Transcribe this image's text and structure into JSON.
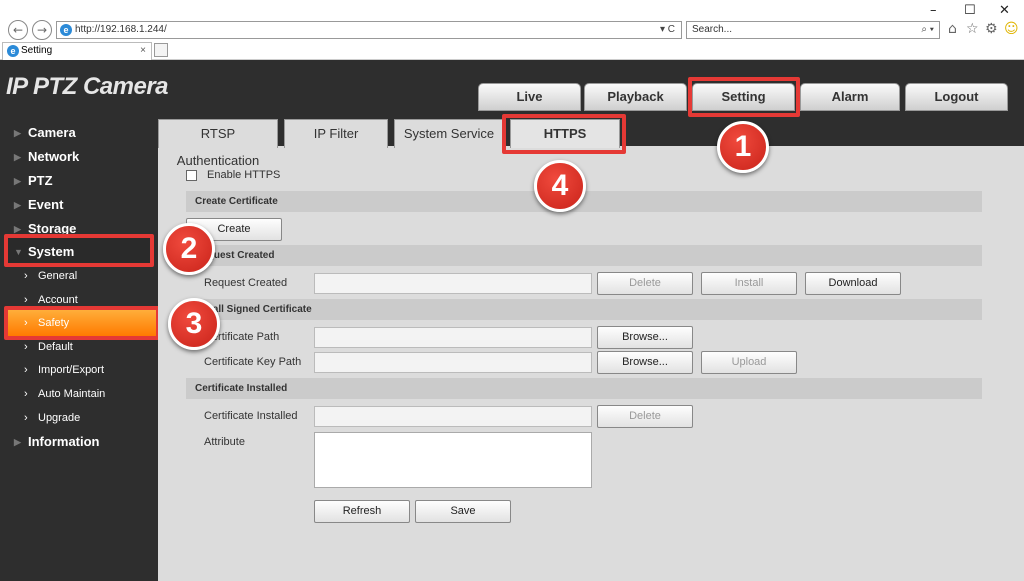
{
  "browser": {
    "url": "http://192.168.1.244/",
    "search_placeholder": "Search...",
    "tab_title": "Setting",
    "minimize": "–",
    "maximize": "☐",
    "close": "✕",
    "back": "←",
    "forward": "→",
    "addr_controls": "▾ C",
    "search_controls": "⌕ ▾",
    "tab_close": "×",
    "browser_icon": "e",
    "icons": [
      "home-icon",
      "star-icon",
      "gear-icon",
      "smiley-icon"
    ]
  },
  "app": {
    "brand": "IP PTZ Camera",
    "main_tabs": [
      {
        "label": "Live"
      },
      {
        "label": "Playback"
      },
      {
        "label": "Setting",
        "active": true
      },
      {
        "label": "Alarm"
      },
      {
        "label": "Logout"
      }
    ],
    "sidebar": {
      "items": [
        {
          "label": "Camera"
        },
        {
          "label": "Network"
        },
        {
          "label": "PTZ"
        },
        {
          "label": "Event"
        },
        {
          "label": "Storage"
        },
        {
          "label": "System",
          "expanded": true
        },
        {
          "label": "Information"
        }
      ],
      "system_subitems": [
        {
          "label": "General"
        },
        {
          "label": "Account"
        },
        {
          "label": "Safety",
          "selected": true
        },
        {
          "label": "Default"
        },
        {
          "label": "Import/Export"
        },
        {
          "label": "Auto Maintain"
        },
        {
          "label": "Upgrade"
        }
      ]
    },
    "sub_tabs": [
      {
        "label": "RTSP Authentication"
      },
      {
        "label": "IP Filter"
      },
      {
        "label": "System Service"
      },
      {
        "label": "HTTPS",
        "active": true
      }
    ],
    "https": {
      "enable_label": "Enable HTTPS",
      "enable_checked": false,
      "create_certificate": {
        "title": "Create Certificate",
        "create_button": "Create"
      },
      "request_created": {
        "title": "Request Created",
        "label": "Request Created",
        "value": "",
        "delete_button": "Delete",
        "install_button": "Install",
        "download_button": "Download"
      },
      "install_signed": {
        "title": "Install Signed Certificate",
        "cert_path_label": "Certificate Path",
        "cert_path_value": "",
        "browse_button": "Browse...",
        "cert_key_label": "Certificate Key Path",
        "cert_key_value": "",
        "browse_button_2": "Browse...",
        "upload_button": "Upload"
      },
      "installed": {
        "title": "Certificate Installed",
        "label": "Certificate Installed",
        "value": "",
        "delete_button": "Delete",
        "attribute_label": "Attribute",
        "attribute_value": ""
      },
      "refresh_button": "Refresh",
      "save_button": "Save"
    },
    "callouts": [
      "1",
      "2",
      "3",
      "4"
    ],
    "colors": {
      "callout": "#e53935",
      "selected_item": "#ff8c1a",
      "app_bg": "#2e2e2e",
      "panel_bg": "#dcdcdc"
    }
  }
}
